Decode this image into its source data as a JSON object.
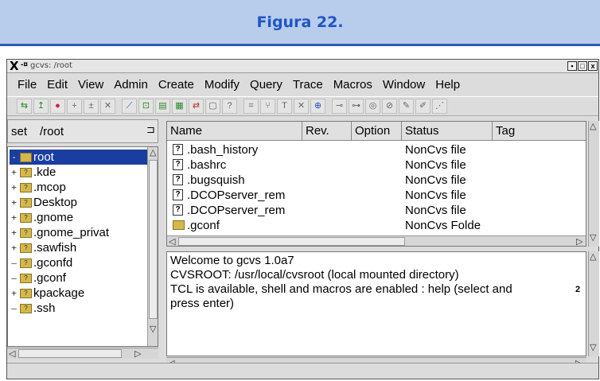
{
  "banner": {
    "title": "Figura 22."
  },
  "window": {
    "title": "gcvs: /root",
    "buttons": [
      "▪",
      "□",
      "x"
    ]
  },
  "menu": [
    "File",
    "Edit",
    "View",
    "Admin",
    "Create",
    "Modify",
    "Query",
    "Trace",
    "Macros",
    "Window",
    "Help"
  ],
  "toolbar_icons": [
    "checkout-icon",
    "update-icon",
    "stop-icon",
    "add-icon",
    "add-binary-icon",
    "remove-icon",
    "graph-icon",
    "commit-icon",
    "diff-icon",
    "log-icon",
    "status-icon",
    "edit-icon",
    "help-icon",
    "tag-icon",
    "branch-icon",
    "text-icon",
    "release-icon",
    "merge-icon",
    "lock-icon",
    "unlock-icon",
    "watch-icon",
    "unwatch-icon",
    "editors-icon",
    "watchers-icon",
    "macro-icon"
  ],
  "left": {
    "set_label": "set",
    "path": "/root",
    "tree": [
      {
        "label": "root",
        "exp": "-",
        "indent": 0,
        "selected": true
      },
      {
        "label": ".kde",
        "exp": "+",
        "indent": 1
      },
      {
        "label": ".mcop",
        "exp": "+",
        "indent": 1
      },
      {
        "label": "Desktop",
        "exp": "+",
        "indent": 1
      },
      {
        "label": ".gnome",
        "exp": "+",
        "indent": 1
      },
      {
        "label": ".gnome_privat",
        "exp": "+",
        "indent": 1
      },
      {
        "label": ".sawfish",
        "exp": "+",
        "indent": 1
      },
      {
        "label": ".gconfd",
        "exp": "",
        "indent": 1
      },
      {
        "label": ".gconf",
        "exp": "",
        "indent": 1
      },
      {
        "label": "kpackage",
        "exp": "+",
        "indent": 1
      },
      {
        "label": ".ssh",
        "exp": "",
        "indent": 1
      }
    ]
  },
  "files": {
    "columns": [
      "Name",
      "Rev.",
      "Option",
      "Status",
      "Tag"
    ],
    "rows": [
      {
        "name": ".bash_history",
        "status": "NonCvs file",
        "icon": "unknown"
      },
      {
        "name": ".bashrc",
        "status": "NonCvs file",
        "icon": "unknown"
      },
      {
        "name": ".bugsquish",
        "status": "NonCvs file",
        "icon": "unknown"
      },
      {
        "name": ".DCOPserver_rem",
        "status": "NonCvs file",
        "icon": "unknown"
      },
      {
        "name": ".DCOPserver_rem",
        "status": "NonCvs file",
        "icon": "unknown"
      },
      {
        "name": ".gconf",
        "status": "NonCvs Folde",
        "icon": "folder"
      }
    ]
  },
  "console": {
    "lines": [
      "Welcome to gcvs 1.0a7",
      "CVSROOT: /usr/local/cvsroot (local mounted directory)",
      "TCL is available, shell and macros are enabled : help (select and",
      "press enter)"
    ],
    "trailing_char": "2"
  }
}
